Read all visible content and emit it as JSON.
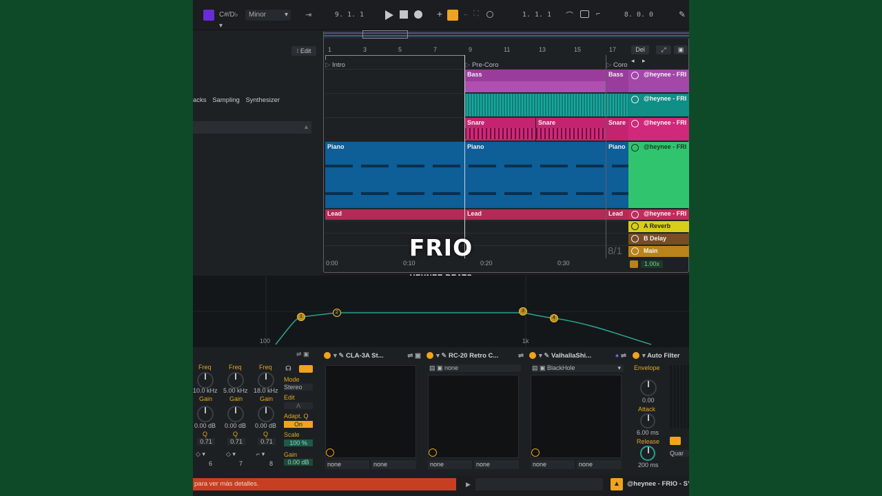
{
  "transport": {
    "key": "C#/D♭",
    "scale": "Minor",
    "position": "9. 1. 1",
    "loop_start": "1. 1. 1",
    "loop_length": "8. 0. 0"
  },
  "browser": {
    "edit_label": "Edit",
    "tags": [
      "acks",
      "Sampling",
      "Synthesizer"
    ]
  },
  "arrangement": {
    "bar_numbers": [
      "1",
      "3",
      "5",
      "7",
      "9",
      "11",
      "13",
      "15",
      "17"
    ],
    "locators": [
      "Intro",
      "Pre-Coro",
      "Coro"
    ],
    "del_label": "Del",
    "time_ticks": [
      "0:00",
      "0:10",
      "0:20",
      "0:30"
    ],
    "time_sig": "8/1",
    "clips": {
      "bass1": "Bass",
      "bass2": "Bass",
      "snare1": "Snare",
      "snare2": "Snare",
      "snare3": "Snare",
      "piano1": "Piano",
      "piano2": "Piano",
      "piano3": "Piano",
      "lead1": "Lead",
      "lead2": "Lead",
      "lead3": "Lead"
    },
    "tracks": [
      "@heynee - FRI",
      "@heynee - FRI",
      "@heynee - FRI",
      "@heynee - FRI",
      "@heynee - FRI"
    ],
    "returns": [
      "A Reverb",
      "B Delay",
      "Main"
    ],
    "zoom": "1.00x"
  },
  "overlay": {
    "title": "FRIO",
    "subtitle": "HEYNEE BEATS"
  },
  "eq": {
    "freq_labels": [
      "100",
      "1k"
    ],
    "points": [
      "1",
      "2",
      "3",
      "4"
    ]
  },
  "eq_params": {
    "col1": {
      "freq_label": "Freq",
      "freq": "10.0 kHz",
      "gain_label": "Gain",
      "gain": "0.00 dB",
      "q_label": "Q",
      "q": "0.71",
      "band": "6"
    },
    "col2": {
      "freq_label": "Freq",
      "freq": "5.00 kHz",
      "gain_label": "Gain",
      "gain": "0.00 dB",
      "q_label": "Q",
      "q": "0.71",
      "band": "7"
    },
    "col3": {
      "freq_label": "Freq",
      "freq": "18.0 kHz",
      "gain_label": "Gain",
      "gain": "0.00 dB",
      "q_label": "Q",
      "q": "0.71",
      "band": "8"
    },
    "mode_label": "Mode",
    "mode": "Stereo",
    "edit_label": "Edit",
    "edit_value": "A",
    "adapt_label": "Adapt. Q",
    "adapt_value": "On",
    "scale_label": "Scale",
    "scale_value": "100 %",
    "gain_label": "Gain",
    "gain_value": "0.00 dB"
  },
  "devices": [
    {
      "name": "CLA-3A St...",
      "preset": "",
      "sel1": "none",
      "sel2": "none"
    },
    {
      "name": "RC-20 Retro C...",
      "preset": "none",
      "sel1": "none",
      "sel2": "none"
    },
    {
      "name": "ValhallaShi...",
      "preset": "BlackHole",
      "sel1": "none",
      "sel2": "none"
    }
  ],
  "autofilter": {
    "name": "Auto Filter",
    "envelope_label": "Envelope",
    "envelope": "0.00",
    "attack_label": "Attack",
    "attack": "6.00 ms",
    "release_label": "Release",
    "release": "200 ms",
    "quant": "Quar"
  },
  "status": {
    "message": "para ver más detalles.",
    "track": "@heynee - FRIO - SY"
  },
  "colors": {
    "bass": "#b04fb0",
    "drums": "#0f8f86",
    "snare": "#d0287a",
    "piano": "#0e63a0",
    "lead": "#c02c5c",
    "green": "#31c46e",
    "reverb": "#d8ce1a",
    "delay": "#7a4c24",
    "main": "#b9821a",
    "accent": "#f0a31c"
  }
}
